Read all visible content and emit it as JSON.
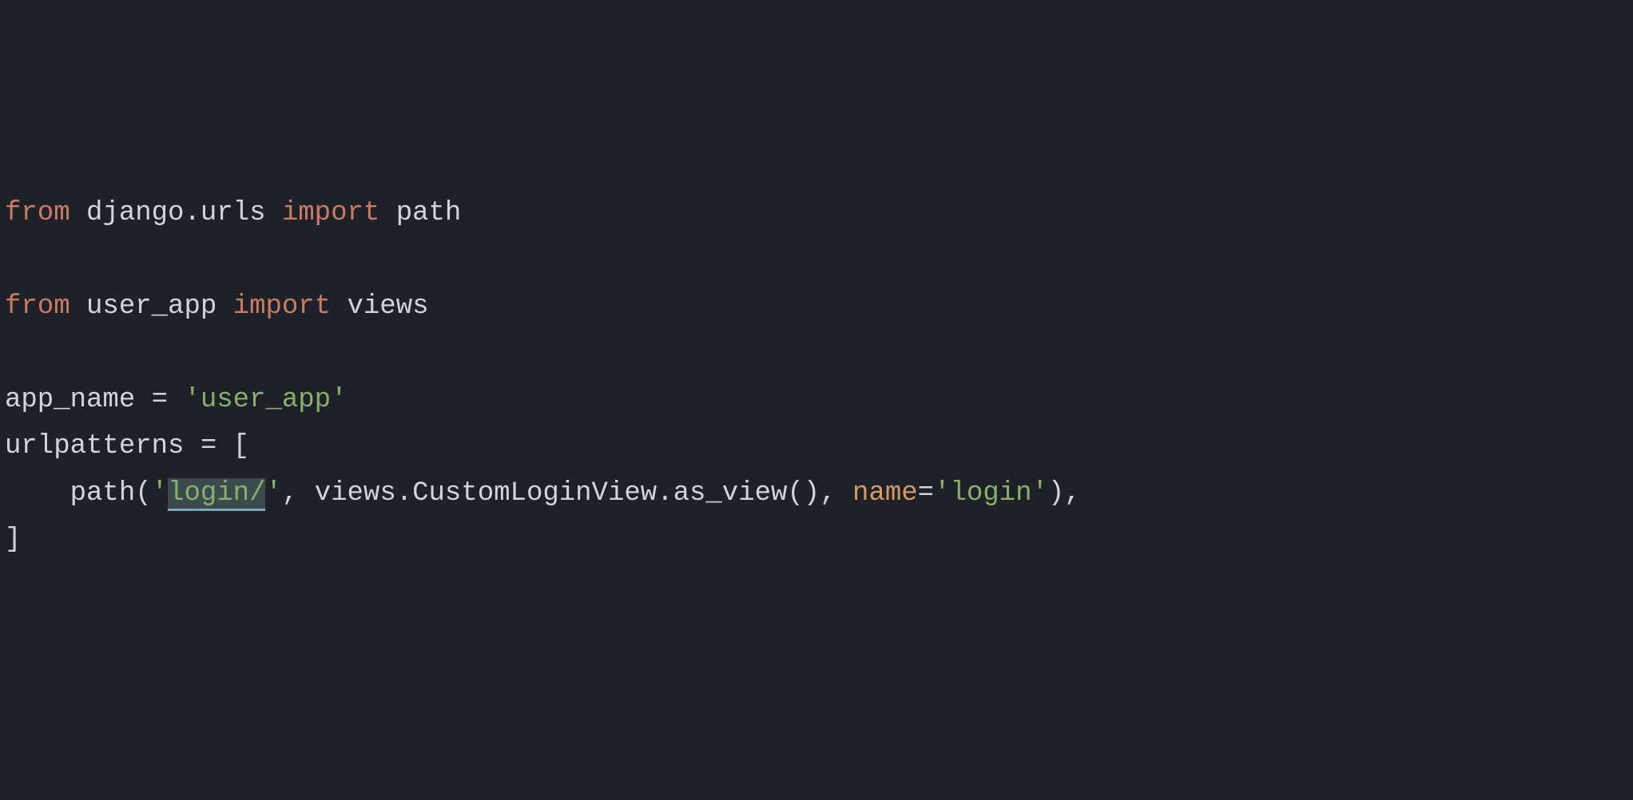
{
  "code": {
    "line1": {
      "from": "from",
      "module": "django.urls",
      "import": "import",
      "name": "path"
    },
    "line2": "",
    "line3": {
      "from": "from",
      "module": "user_app",
      "import": "import",
      "name": "views"
    },
    "line4": "",
    "line5": {
      "var": "app_name",
      "eq": " = ",
      "q1": "'",
      "val": "user_app",
      "q2": "'"
    },
    "line6": {
      "var": "urlpatterns",
      "eq": " = ",
      "bracket": "["
    },
    "line7": {
      "indent": "    ",
      "func": "path",
      "open": "(",
      "q1": "'",
      "sel": "login/",
      "q2": "'",
      "comma1": ", ",
      "views": "views.CustomLoginView.as_view",
      "parens": "()",
      "comma2": ", ",
      "param": "name",
      "eq": "=",
      "q3": "'",
      "val": "login",
      "q4": "'",
      "close": "),"
    },
    "line8": {
      "bracket": "]"
    }
  }
}
